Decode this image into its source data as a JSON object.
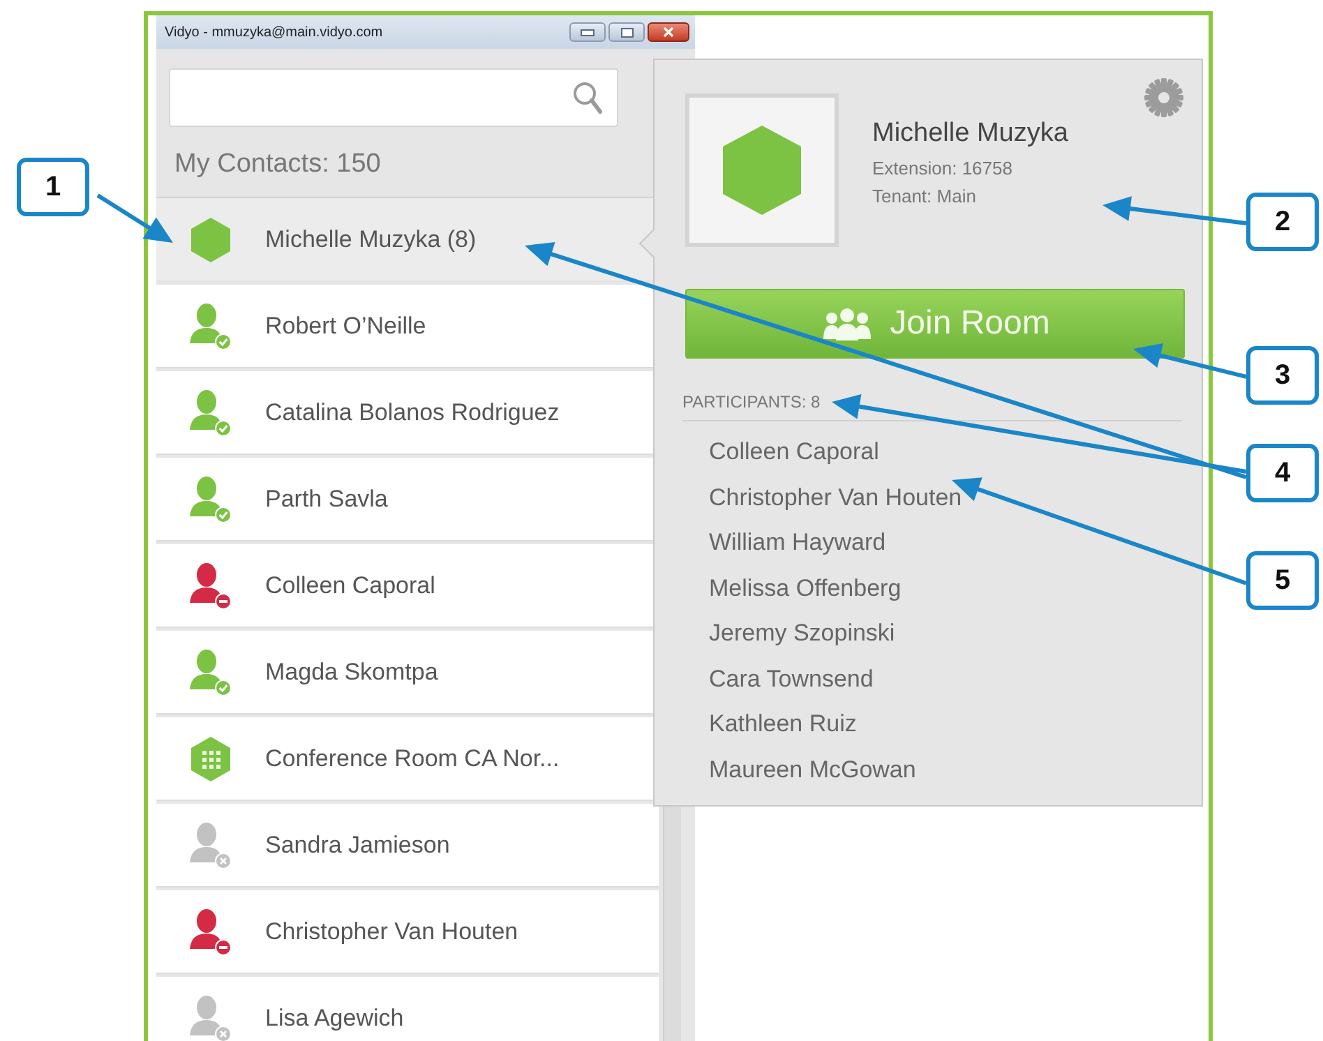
{
  "window": {
    "title": "Vidyo - mmuzyka@main.vidyo.com"
  },
  "contacts_header": "My Contacts: 150",
  "contacts": [
    {
      "name": "Michelle Muzyka (8)",
      "kind": "room",
      "selected": true
    },
    {
      "name": "Robert O’Neille",
      "kind": "online",
      "selected": false
    },
    {
      "name": "Catalina Bolanos Rodriguez",
      "kind": "online",
      "selected": false
    },
    {
      "name": "Parth Savla",
      "kind": "online",
      "selected": false
    },
    {
      "name": "Colleen Caporal",
      "kind": "busy",
      "selected": false
    },
    {
      "name": "Magda Skomtpa",
      "kind": "online",
      "selected": false
    },
    {
      "name": "Conference Room CA Nor...",
      "kind": "conference",
      "selected": false
    },
    {
      "name": "Sandra Jamieson",
      "kind": "offline",
      "selected": false
    },
    {
      "name": "Christopher Van Houten",
      "kind": "busy",
      "selected": false
    },
    {
      "name": "Lisa Agewich",
      "kind": "offline",
      "selected": false
    }
  ],
  "popup": {
    "name": "Michelle Muzyka",
    "extension": "Extension: 16758",
    "tenant": "Tenant: Main",
    "join_button": "Join Room",
    "participants_label": "PARTICIPANTS: 8",
    "participants": [
      "Colleen Caporal",
      "Christopher Van Houten",
      "William Hayward",
      "Melissa Offenberg",
      "Jeremy Szopinski",
      "Cara Townsend",
      "Kathleen Ruiz",
      "Maureen McGowan"
    ]
  },
  "callouts": [
    {
      "label": "1"
    },
    {
      "label": "2"
    },
    {
      "label": "3"
    },
    {
      "label": "4"
    },
    {
      "label": "5"
    }
  ]
}
